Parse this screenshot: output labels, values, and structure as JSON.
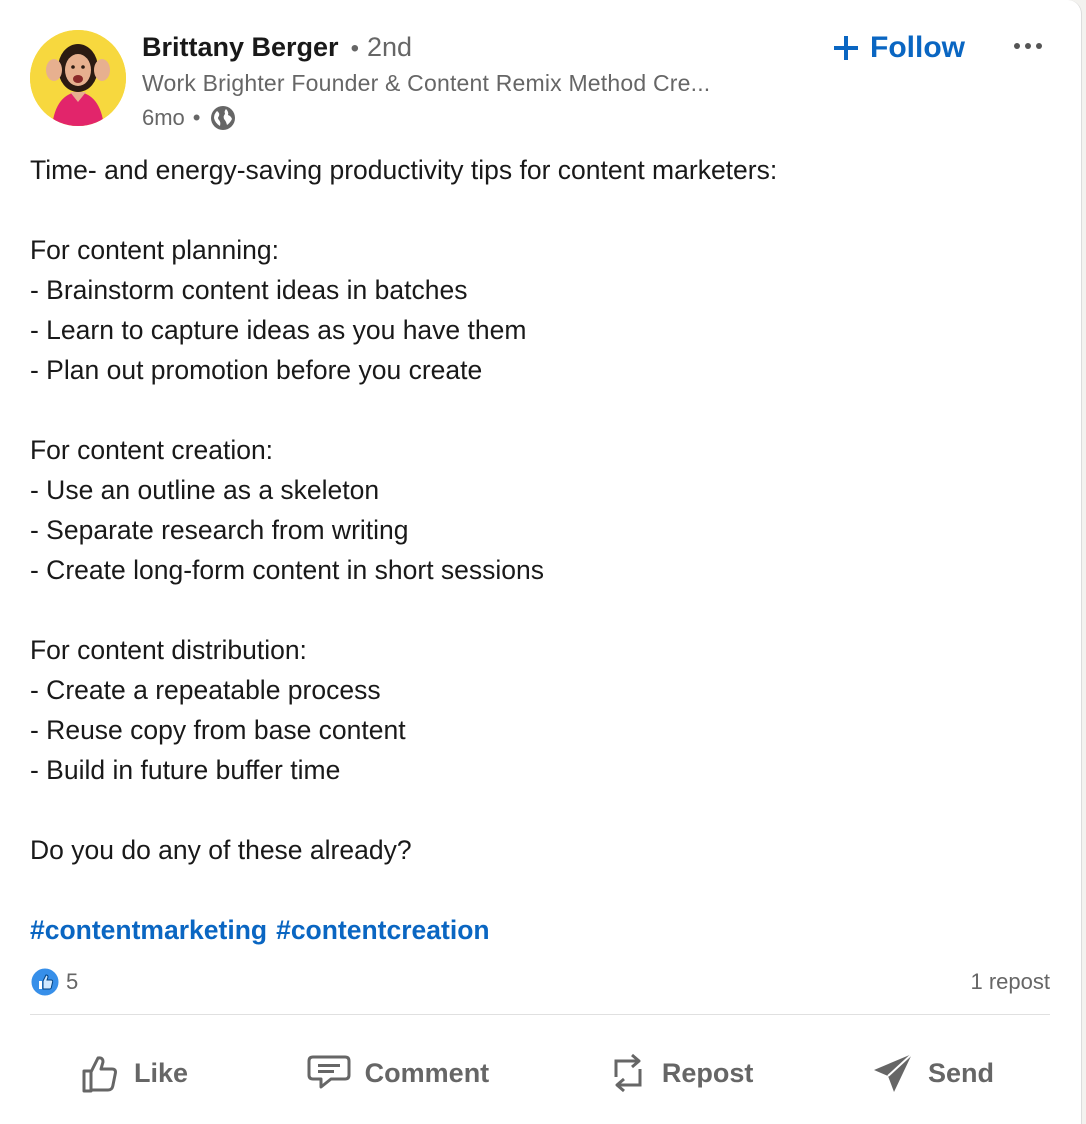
{
  "author": {
    "name": "Brittany Berger",
    "separator": "•",
    "degree": "2nd",
    "headline": "Work Brighter Founder & Content Remix Method Cre...",
    "time": "6mo",
    "visibility_icon": "globe-icon",
    "avatar_bg": "#f7d83e"
  },
  "follow_label": "+ Follow",
  "follow_text": "Follow",
  "more_icon": "ellipsis-icon",
  "post_lines": [
    "Time- and energy-saving productivity tips for content marketers:",
    "",
    "For content planning:",
    "- Brainstorm content ideas in batches",
    "- Learn to capture ideas as you have them",
    "- Plan out promotion before you create",
    "",
    "For content creation:",
    "- Use an outline as a skeleton",
    "- Separate research from writing",
    "- Create long-form content in short sessions",
    "",
    "For content distribution:",
    "- Create a repeatable process",
    "- Reuse copy from base content",
    "- Build in future buffer time",
    "",
    "Do you do any of these already?"
  ],
  "hashtags": [
    "#contentmarketing",
    "#contentcreation"
  ],
  "social": {
    "reaction_icon": "like-reaction-icon",
    "reaction_count": "5",
    "reposts": "1 repost"
  },
  "actions": {
    "like": "Like",
    "comment": "Comment",
    "repost": "Repost",
    "send": "Send"
  },
  "colors": {
    "accent": "#0a66c2",
    "muted_text": "#666666",
    "avatar_bg": "#f7d83e"
  }
}
